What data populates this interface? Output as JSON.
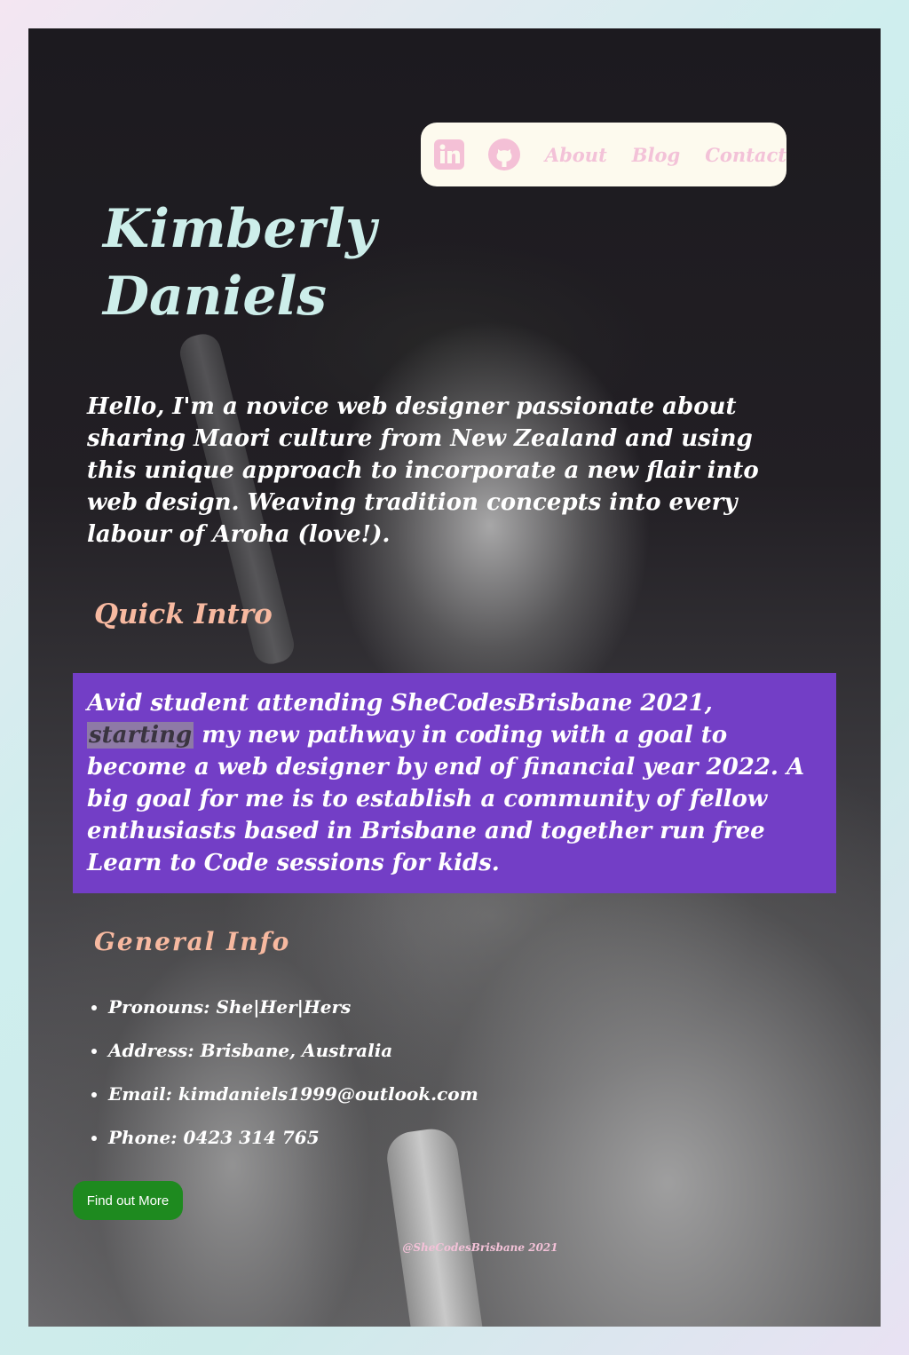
{
  "nav": {
    "linkedin_icon": "linkedin-icon",
    "github_icon": "github-icon",
    "links": [
      "About",
      "Blog",
      "Contact"
    ],
    "icon_color": "#f4c0d6"
  },
  "hero": {
    "name_line1": "Kimberly",
    "name_line2": "Daniels",
    "intro": "Hello, I'm a novice web designer passionate about sharing Maori culture from New Zealand and using this unique approach to incorporate a new flair into web design. Weaving tradition concepts into every labour of Aroha (love!)."
  },
  "quick_intro": {
    "heading": "Quick Intro",
    "text_before": "Avid student attending SheCodesBrisbane 2021, ",
    "highlight": "starting",
    "text_after": " my new pathway in coding with a goal to become a web designer by end of financial year 2022. A big goal for me is to establish a community of fellow enthusiasts based in Brisbane and together run free Learn to Code sessions for kids.",
    "box_color": "#733ec6"
  },
  "general_info": {
    "heading": "General Info",
    "items": [
      "Pronouns: She|Her|Hers",
      "Address: Brisbane, Australia",
      "Email: kimdaniels1999@outlook.com",
      "Phone: 0423 314 765"
    ]
  },
  "cta": {
    "label": "Find out More",
    "color": "#1e8a1f"
  },
  "footer": {
    "text": "@SheCodesBrisbane 2021"
  }
}
